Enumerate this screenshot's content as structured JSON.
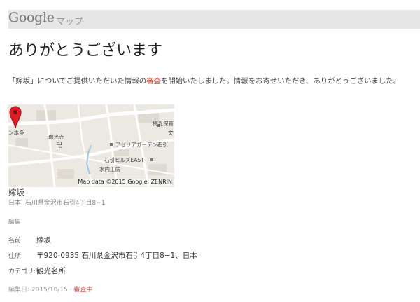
{
  "header": {
    "logo_text": "Google",
    "product_name": "マップ"
  },
  "page_title": "ありがとうございます",
  "message": {
    "part1": "「嫁坂」についてご提供いただいた情報の",
    "link": "審査",
    "part2": "を開始いたしました。情報をお寄せいただき、ありがとうございました。"
  },
  "map": {
    "labels": {
      "honda": "ン本多",
      "zuikoji": "瑞光寺",
      "umemitsu": "梅光保育",
      "bun": "文",
      "azalea": "アゼリアガーデン石引",
      "hills": "石引ヒルズEAST",
      "mizuuchi": "水内工房"
    },
    "attribution": "Map data ©2015 Google, ZENRIN",
    "pin_color": "#e01b24"
  },
  "place": {
    "name": "嫁坂",
    "address_short": "日本, 石川県金沢市石引4丁目8−1",
    "edit_label": "編集"
  },
  "details": {
    "name_label": "名前:",
    "name_value": "嫁坂",
    "address_label": "住所:",
    "address_value": "〒920-0935 石川県金沢市石引4丁目8−1、日本",
    "category_label": "カテゴリ:",
    "category_value": "観光名所"
  },
  "footer": {
    "edited_prefix": "編集日: ",
    "edited_date": "2015/10/15",
    "separator": " · ",
    "status": "審査中"
  }
}
